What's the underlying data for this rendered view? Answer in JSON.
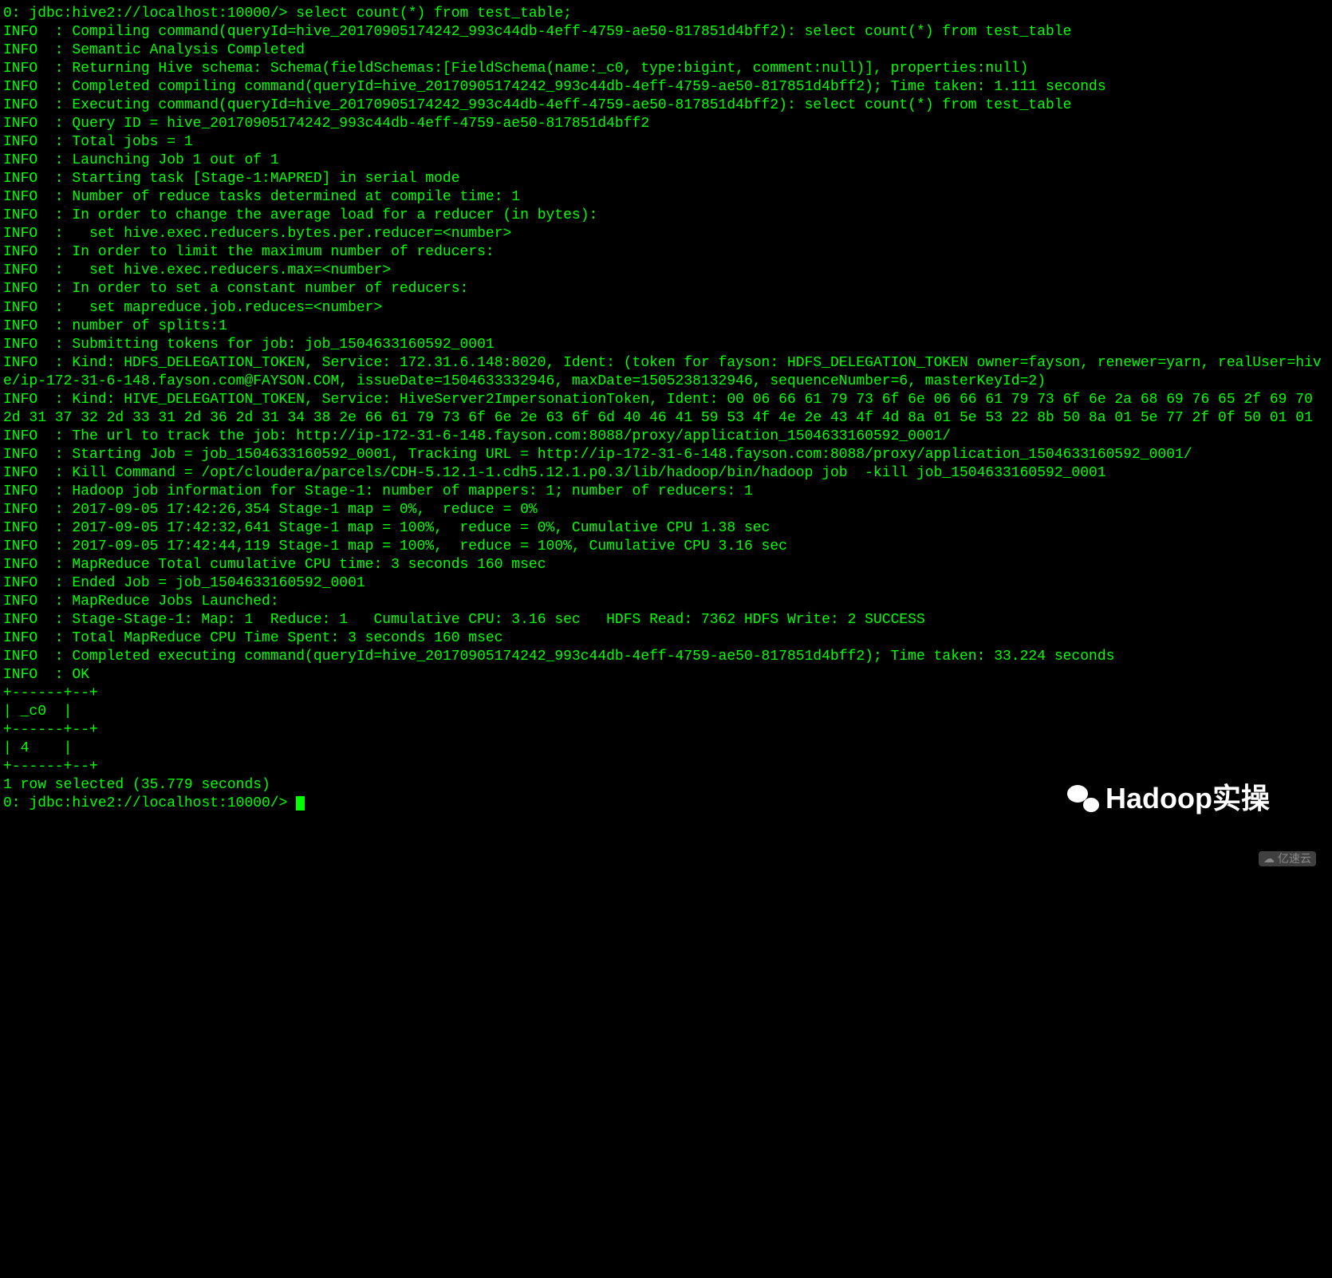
{
  "prompt": "0: jdbc:hive2://localhost:10000/> ",
  "cmd": "select count(*) from test_table;",
  "lines": [
    "INFO  : Compiling command(queryId=hive_20170905174242_993c44db-4eff-4759-ae50-817851d4bff2): select count(*) from test_table",
    "INFO  : Semantic Analysis Completed",
    "INFO  : Returning Hive schema: Schema(fieldSchemas:[FieldSchema(name:_c0, type:bigint, comment:null)], properties:null)",
    "INFO  : Completed compiling command(queryId=hive_20170905174242_993c44db-4eff-4759-ae50-817851d4bff2); Time taken: 1.111 seconds",
    "INFO  : Executing command(queryId=hive_20170905174242_993c44db-4eff-4759-ae50-817851d4bff2): select count(*) from test_table",
    "INFO  : Query ID = hive_20170905174242_993c44db-4eff-4759-ae50-817851d4bff2",
    "INFO  : Total jobs = 1",
    "INFO  : Launching Job 1 out of 1",
    "INFO  : Starting task [Stage-1:MAPRED] in serial mode",
    "INFO  : Number of reduce tasks determined at compile time: 1",
    "INFO  : In order to change the average load for a reducer (in bytes):",
    "INFO  :   set hive.exec.reducers.bytes.per.reducer=<number>",
    "INFO  : In order to limit the maximum number of reducers:",
    "INFO  :   set hive.exec.reducers.max=<number>",
    "INFO  : In order to set a constant number of reducers:",
    "INFO  :   set mapreduce.job.reduces=<number>",
    "INFO  : number of splits:1",
    "INFO  : Submitting tokens for job: job_1504633160592_0001",
    "INFO  : Kind: HDFS_DELEGATION_TOKEN, Service: 172.31.6.148:8020, Ident: (token for fayson: HDFS_DELEGATION_TOKEN owner=fayson, renewer=yarn, realUser=hive/ip-172-31-6-148.fayson.com@FAYSON.COM, issueDate=1504633332946, maxDate=1505238132946, sequenceNumber=6, masterKeyId=2)",
    "INFO  : Kind: HIVE_DELEGATION_TOKEN, Service: HiveServer2ImpersonationToken, Ident: 00 06 66 61 79 73 6f 6e 06 66 61 79 73 6f 6e 2a 68 69 76 65 2f 69 70 2d 31 37 32 2d 33 31 2d 36 2d 31 34 38 2e 66 61 79 73 6f 6e 2e 63 6f 6d 40 46 41 59 53 4f 4e 2e 43 4f 4d 8a 01 5e 53 22 8b 50 8a 01 5e 77 2f 0f 50 01 01",
    "INFO  : The url to track the job: http://ip-172-31-6-148.fayson.com:8088/proxy/application_1504633160592_0001/",
    "INFO  : Starting Job = job_1504633160592_0001, Tracking URL = http://ip-172-31-6-148.fayson.com:8088/proxy/application_1504633160592_0001/",
    "INFO  : Kill Command = /opt/cloudera/parcels/CDH-5.12.1-1.cdh5.12.1.p0.3/lib/hadoop/bin/hadoop job  -kill job_1504633160592_0001",
    "INFO  : Hadoop job information for Stage-1: number of mappers: 1; number of reducers: 1",
    "INFO  : 2017-09-05 17:42:26,354 Stage-1 map = 0%,  reduce = 0%",
    "INFO  : 2017-09-05 17:42:32,641 Stage-1 map = 100%,  reduce = 0%, Cumulative CPU 1.38 sec",
    "INFO  : 2017-09-05 17:42:44,119 Stage-1 map = 100%,  reduce = 100%, Cumulative CPU 3.16 sec",
    "INFO  : MapReduce Total cumulative CPU time: 3 seconds 160 msec",
    "INFO  : Ended Job = job_1504633160592_0001",
    "INFO  : MapReduce Jobs Launched:",
    "INFO  : Stage-Stage-1: Map: 1  Reduce: 1   Cumulative CPU: 3.16 sec   HDFS Read: 7362 HDFS Write: 2 SUCCESS",
    "INFO  : Total MapReduce CPU Time Spent: 3 seconds 160 msec",
    "INFO  : Completed executing command(queryId=hive_20170905174242_993c44db-4eff-4759-ae50-817851d4bff2); Time taken: 33.224 seconds",
    "INFO  : OK",
    "+------+--+",
    "| _c0  |",
    "+------+--+",
    "| 4    |",
    "+------+--+",
    "1 row selected (35.779 seconds)"
  ],
  "prompt2": "0: jdbc:hive2://localhost:10000/> ",
  "watermark1": "Hadoop实操",
  "watermark2": "亿速云"
}
